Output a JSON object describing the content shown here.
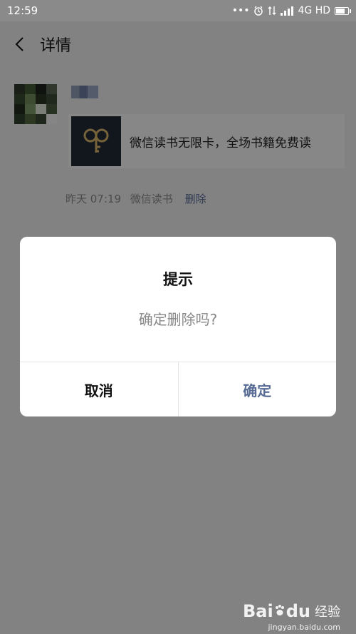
{
  "status_bar": {
    "time": "12:59",
    "dots": "•••",
    "network": "4G HD"
  },
  "header": {
    "title": "详情"
  },
  "post": {
    "share_card_text": "微信读书无限卡，全场书籍免费读",
    "time": "昨天 07:19",
    "source": "微信读书",
    "delete_label": "删除"
  },
  "dialog": {
    "title": "提示",
    "message": "确定删除吗?",
    "cancel_label": "取消",
    "confirm_label": "确定"
  },
  "watermark": {
    "logo": "Bai",
    "logo_tail": "du",
    "text": "经验",
    "sub": "jingyan.baidu.com"
  },
  "colors": {
    "link": "#576b95",
    "overlay": "rgba(0,0,0,0.45)"
  }
}
